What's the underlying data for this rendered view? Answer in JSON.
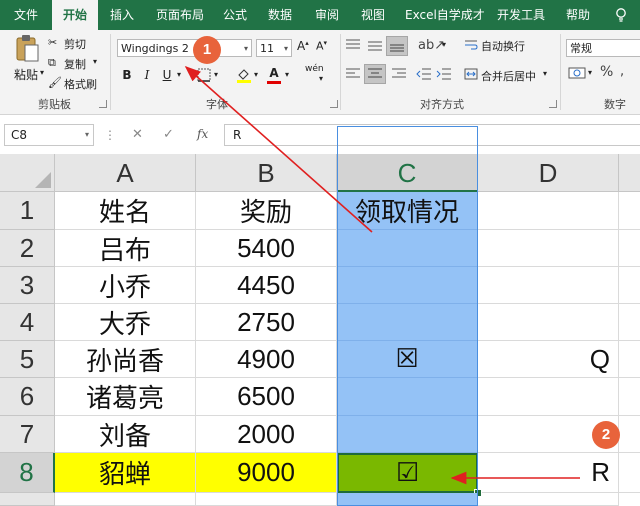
{
  "ribbon_tabs": [
    "文件",
    "开始",
    "插入",
    "页面布局",
    "公式",
    "数据",
    "审阅",
    "视图",
    "Excel自学成才",
    "开发工具",
    "帮助"
  ],
  "active_tab": "开始",
  "clipboard": {
    "paste": "粘贴",
    "cut": "剪切",
    "copy": "复制",
    "format_painter": "格式刷",
    "group_label": "剪贴板"
  },
  "font": {
    "name": "Wingdings 2",
    "size": "11",
    "bold": "B",
    "italic": "I",
    "underline": "U",
    "font_color_glyph": "A",
    "phonetic_glyph": "wén",
    "group_label": "字体"
  },
  "alignment": {
    "wrap_text": "自动换行",
    "merge_center": "合并后居中",
    "group_label": "对齐方式"
  },
  "number": {
    "format": "常规",
    "group_label": "数字"
  },
  "formula_bar": {
    "name_box": "C8",
    "cancel": "✕",
    "enter": "✓",
    "fx": "fx",
    "content": "R"
  },
  "columns": [
    "A",
    "B",
    "C",
    "D"
  ],
  "row_numbers": [
    "1",
    "2",
    "3",
    "4",
    "5",
    "6",
    "7",
    "8"
  ],
  "rows": [
    {
      "a": "姓名",
      "b": "奖励",
      "c": "领取情况",
      "d": ""
    },
    {
      "a": "吕布",
      "b": "5400",
      "c": "",
      "d": ""
    },
    {
      "a": "小乔",
      "b": "4450",
      "c": "",
      "d": ""
    },
    {
      "a": "大乔",
      "b": "2750",
      "c": "",
      "d": ""
    },
    {
      "a": "孙尚香",
      "b": "4900",
      "c": "☒",
      "d": "Q"
    },
    {
      "a": "诸葛亮",
      "b": "6500",
      "c": "",
      "d": ""
    },
    {
      "a": "刘备",
      "b": "2000",
      "c": "",
      "d": ""
    },
    {
      "a": "貂蝉",
      "b": "9000",
      "c": "☑",
      "d": "R"
    }
  ],
  "selected_cell": "C8",
  "annotations": [
    "1",
    "2"
  ],
  "colors": {
    "excel_green": "#217346",
    "highlight_yellow": "#ffff00",
    "column_selection_blue": "#94c2f6",
    "active_cell_green": "#7ab800",
    "annotation_red": "#e8633b",
    "arrow_red": "#e02020"
  }
}
